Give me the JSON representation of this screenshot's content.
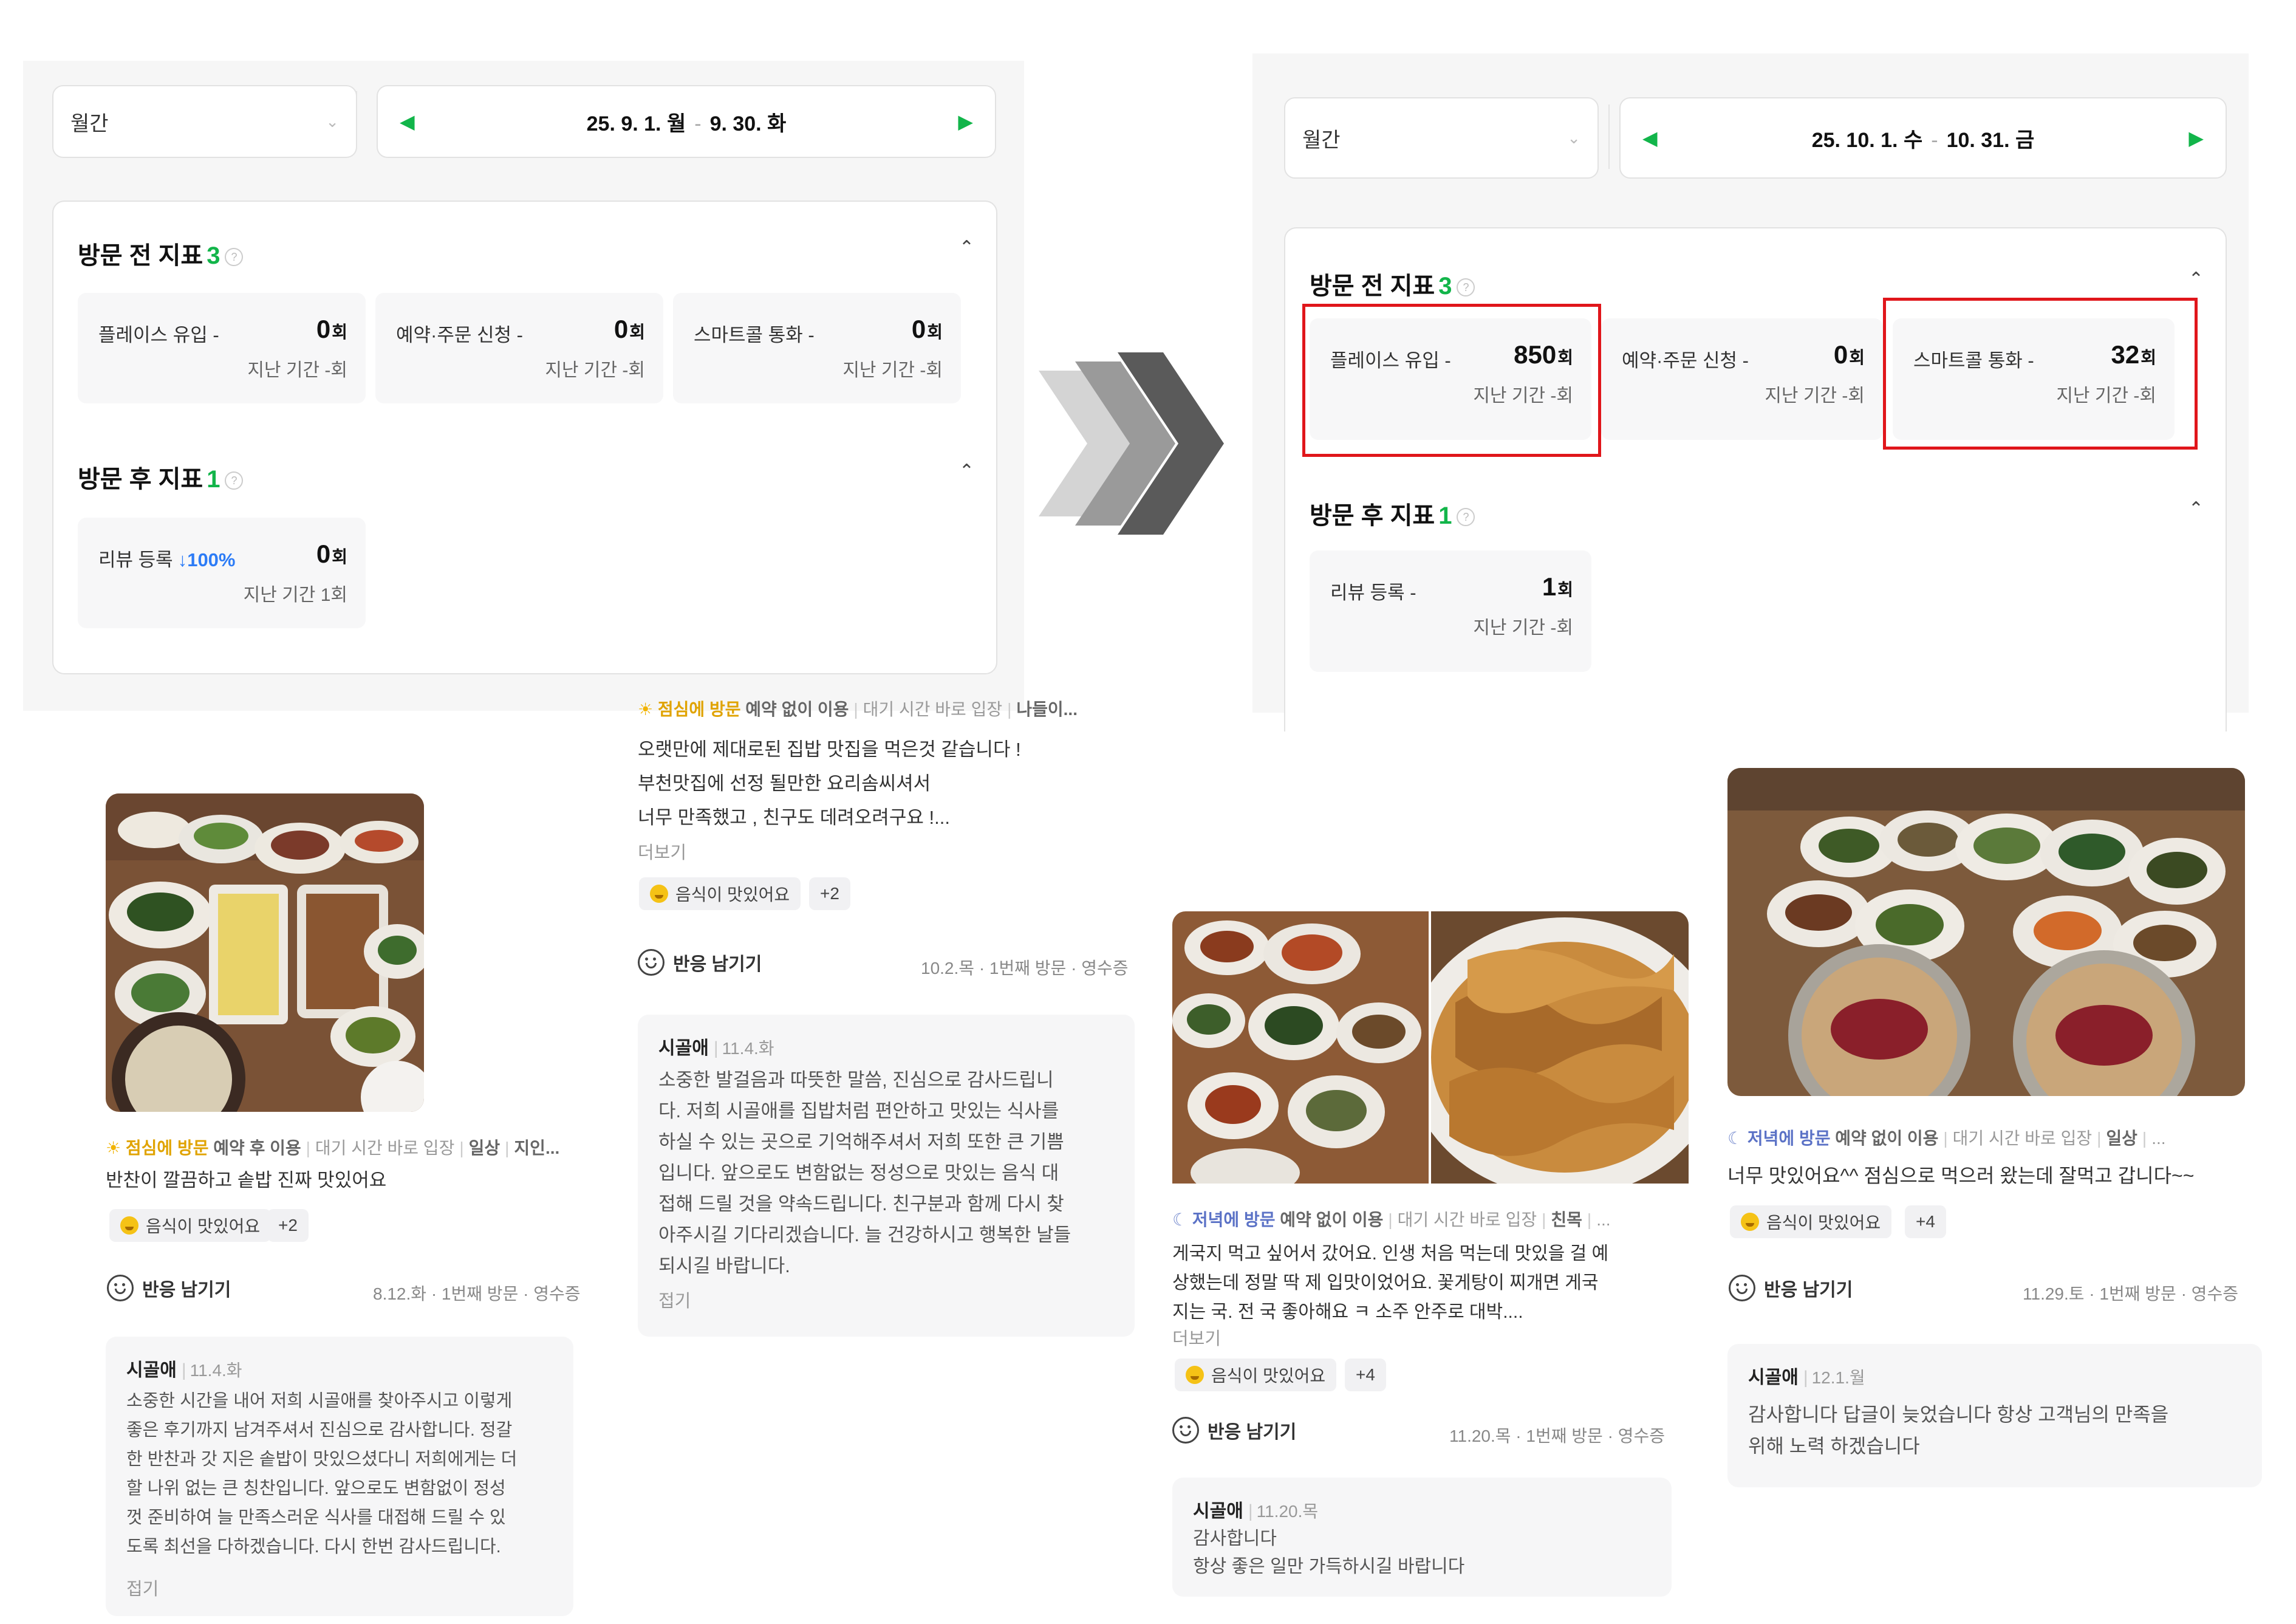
{
  "left_panel": {
    "period": "월간",
    "date_range": [
      "25. 9. 1. 월",
      "9. 30. 화"
    ],
    "pre_title": "방문 전 지표",
    "pre_count": "3",
    "post_title": "방문 후 지표",
    "post_count": "1",
    "pre_metrics": [
      {
        "label": "플레이스 유입 -",
        "value": "0",
        "unit": "회",
        "prev": "지난 기간 -회"
      },
      {
        "label": "예약·주문 신청 -",
        "value": "0",
        "unit": "회",
        "prev": "지난 기간 -회"
      },
      {
        "label": "스마트콜 통화 -",
        "value": "0",
        "unit": "회",
        "prev": "지난 기간 -회"
      }
    ],
    "post_metrics": [
      {
        "label": "리뷰 등록",
        "change": "↓100%",
        "value": "0",
        "unit": "회",
        "prev": "지난 기간 1회"
      }
    ]
  },
  "right_panel": {
    "period": "월간",
    "date_range": [
      "25. 10. 1. 수",
      "10. 31. 금"
    ],
    "pre_title": "방문 전 지표",
    "pre_count": "3",
    "post_title": "방문 후 지표",
    "post_count": "1",
    "pre_metrics": [
      {
        "label": "플레이스 유입 -",
        "value": "850",
        "unit": "회",
        "prev": "지난 기간 -회"
      },
      {
        "label": "예약·주문 신청 -",
        "value": "0",
        "unit": "회",
        "prev": "지난 기간 -회"
      },
      {
        "label": "스마트콜 통화 -",
        "value": "32",
        "unit": "회",
        "prev": "지난 기간 -회"
      }
    ],
    "post_metrics": [
      {
        "label": "리뷰 등록 -",
        "value": "1",
        "unit": "회",
        "prev": "지난 기간 -회"
      }
    ]
  },
  "colors": {
    "accent_green": "#12b54a",
    "highlight_red": "#e0161b",
    "down_blue": "#2d7cf6"
  },
  "reviews": [
    {
      "meta_when": "점심에 방문",
      "meta_rest": [
        "예약 후 이용",
        "대기 시간 바로 입장",
        "일상",
        "지인..."
      ],
      "text": [
        "반찬이 깔끔하고 솥밥 진짜 맛있어요"
      ],
      "chip": "음식이 맛있어요",
      "chip_more": "+2",
      "react": "반응 남기기",
      "visit": "8.12.화 · 1번째 방문 · 영수증",
      "reply_who": "시골애",
      "reply_date": "11.4.화",
      "reply": [
        "소중한 시간을 내어 저희 시골애를 찾아주시고 이렇게",
        "좋은 후기까지 남겨주셔서 진심으로 감사합니다. 정갈",
        "한 반찬과 갓 지은 솥밥이 맛있으셨다니 저희에게는 더",
        "할 나위 없는 큰 칭찬입니다. 앞으로도 변함없이 정성",
        "껏 준비하여 늘 만족스러운 식사를 대접해 드릴 수 있",
        "도록 최선을 다하겠습니다. 다시 한번 감사드립니다."
      ],
      "reply_toggle": "접기"
    },
    {
      "meta_when": "점심에 방문",
      "meta_rest": [
        "예약 없이 이용",
        "대기 시간 바로 입장",
        "나들이..."
      ],
      "text": [
        "오랫만에 제대로된 집밥 맛집을 먹은것 같습니다 !",
        "부천맛집에 선정 될만한 요리솜씨셔서",
        "너무 만족했고 , 친구도 데려오려구요 !..."
      ],
      "more": "더보기",
      "chip": "음식이 맛있어요",
      "chip_more": "+2",
      "react": "반응 남기기",
      "visit": "10.2.목 · 1번째 방문 · 영수증",
      "reply_who": "시골애",
      "reply_date": "11.4.화",
      "reply": [
        "소중한 발걸음과 따뜻한 말씀, 진심으로 감사드립니",
        "다. 저희 시골애를 집밥처럼 편안하고 맛있는 식사를",
        "하실 수 있는 곳으로 기억해주셔서 저희 또한 큰 기쁨",
        "입니다. 앞으로도 변함없는 정성으로 맛있는 음식 대",
        "접해 드릴 것을 약속드립니다. 친구분과 함께 다시 찾",
        "아주시길 기다리겠습니다. 늘 건강하시고 행복한 날들",
        "되시길 바랍니다."
      ],
      "reply_toggle": "접기"
    },
    {
      "meta_when": "저녁에 방문",
      "meta_rest": [
        "예약 없이 이용",
        "대기 시간 바로 입장",
        "친목",
        "..."
      ],
      "text": [
        "게국지 먹고 싶어서 갔어요. 인생 처음 먹는데 맛있을 걸 예",
        "상했는데 정말 딱 제 입맛이었어요. 꽃게탕이 찌개면 게국",
        "지는 국. 전 국 좋아해요 ㅋ 소주 안주로 대박...."
      ],
      "more": "더보기",
      "chip": "음식이 맛있어요",
      "chip_more": "+4",
      "react": "반응 남기기",
      "visit": "11.20.목 · 1번째 방문 · 영수증",
      "reply_who": "시골애",
      "reply_date": "11.20.목",
      "reply": [
        "감사합니다",
        "항상 좋은 일만 가득하시길 바랍니다"
      ]
    },
    {
      "meta_when": "저녁에 방문",
      "meta_rest": [
        "예약 없이 이용",
        "대기 시간 바로 입장",
        "일상",
        "..."
      ],
      "text": [
        "너무 맛있어요^^ 점심으로 먹으러 왔는데 잘먹고 갑니다~~"
      ],
      "chip": "음식이 맛있어요",
      "chip_more": "+4",
      "react": "반응 남기기",
      "visit": "11.29.토 · 1번째 방문 · 영수증",
      "reply_who": "시골애",
      "reply_date": "12.1.월",
      "reply": [
        "감사합니다 답글이 늦었습니다 항상 고객님의 만족을",
        "위해 노력 하겠습니다"
      ]
    }
  ]
}
